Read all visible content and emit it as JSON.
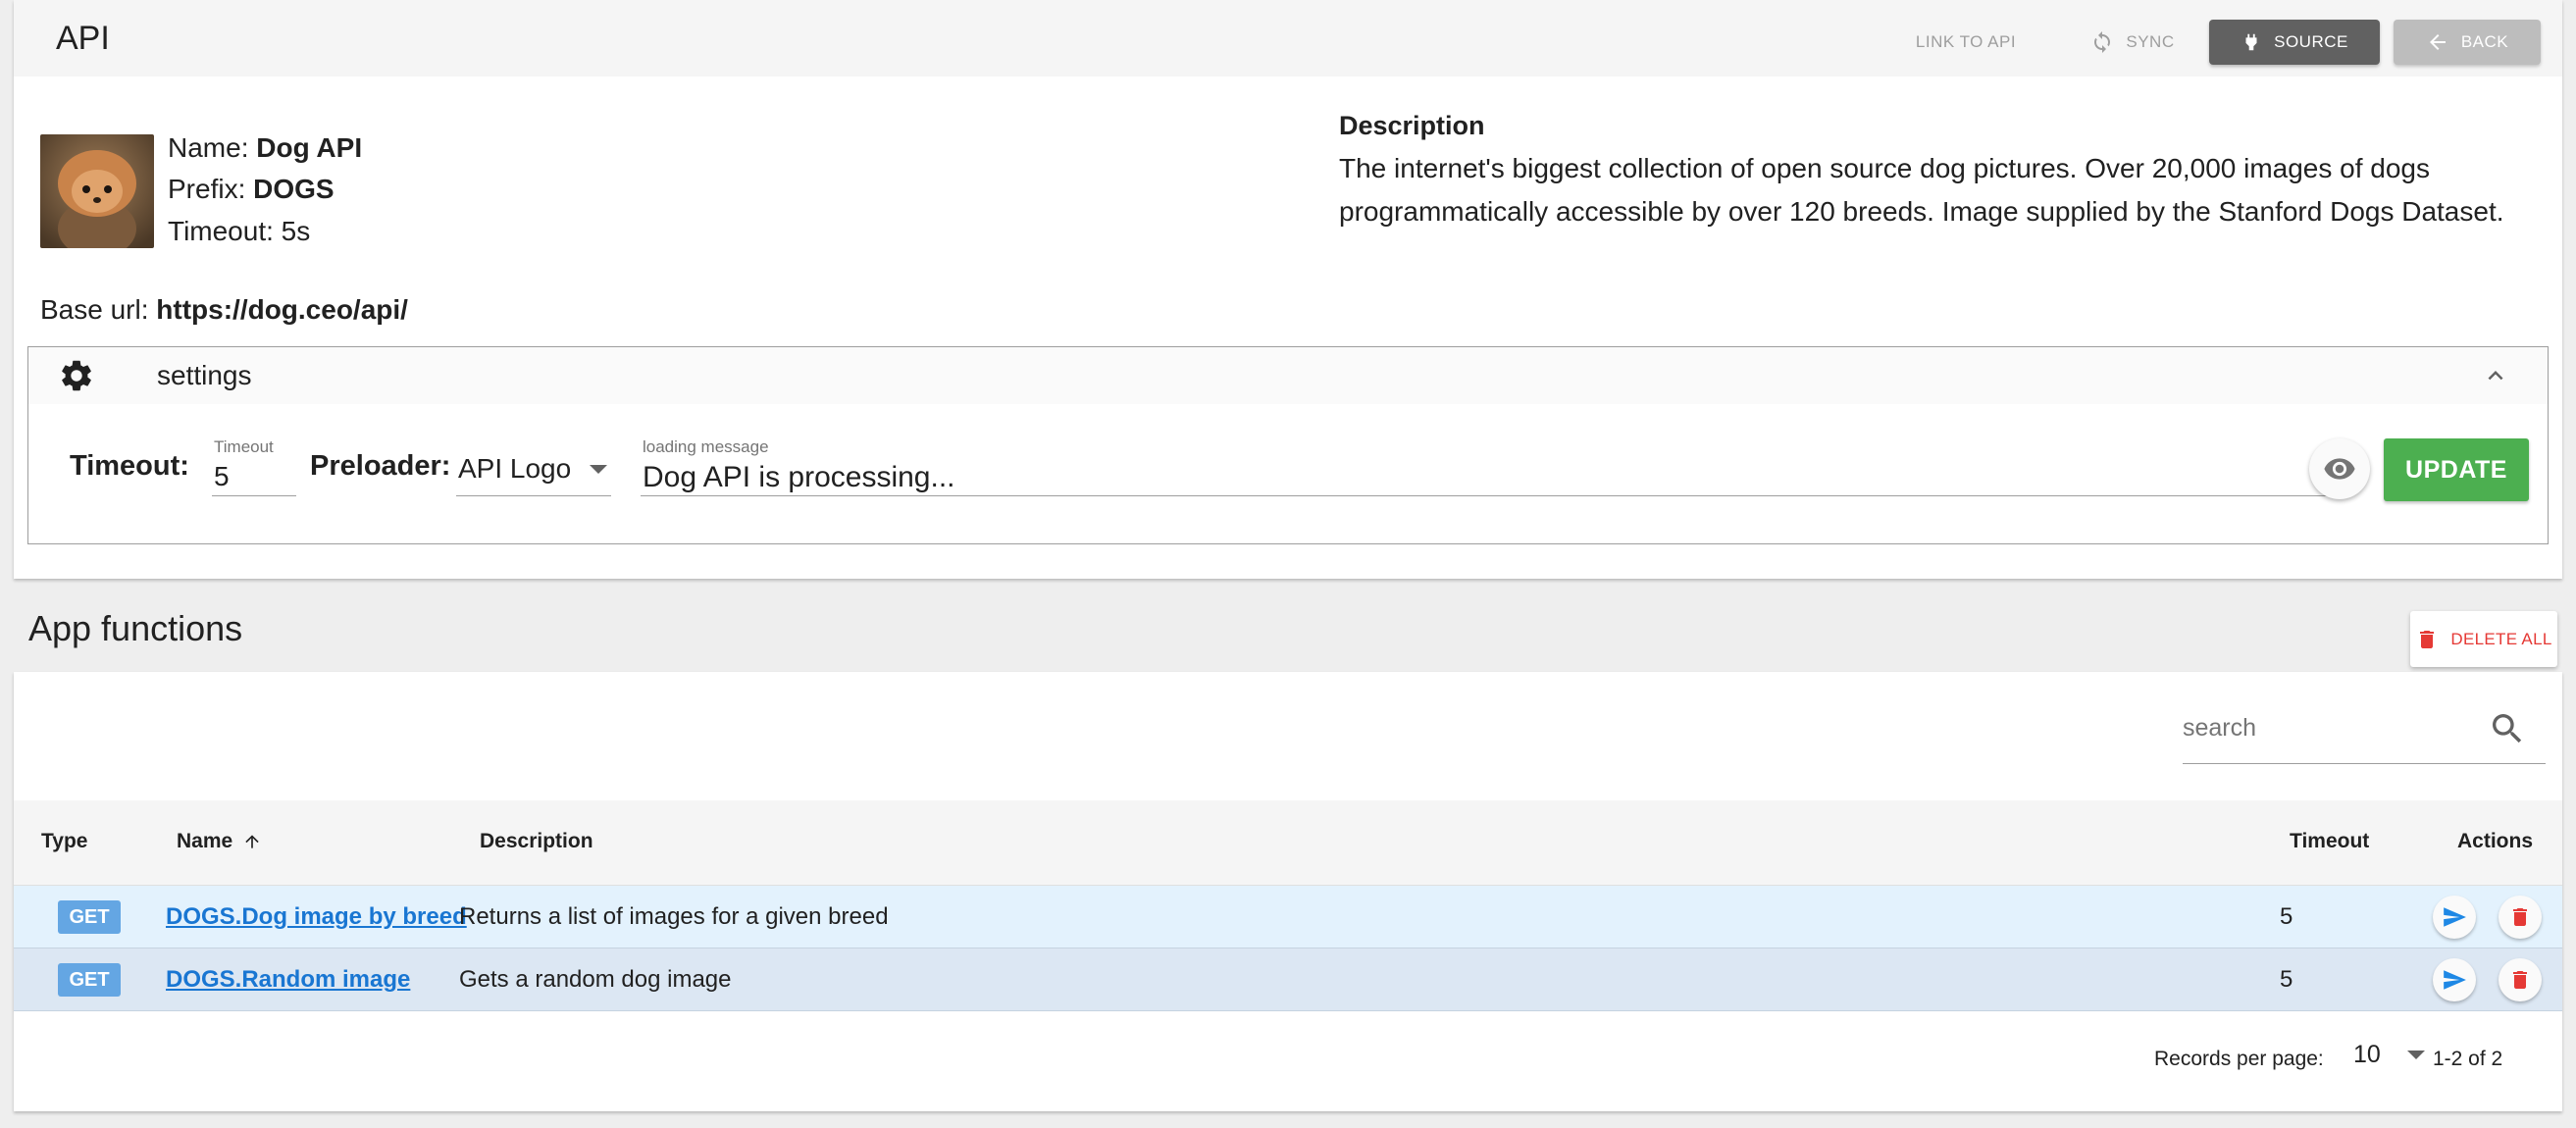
{
  "toolbar": {
    "title": "API",
    "link_label": "LINK TO API",
    "sync_label": "SYNC",
    "source_label": "SOURCE",
    "back_label": "BACK"
  },
  "api": {
    "name_label": "Name:",
    "name": "Dog API",
    "prefix_label": "Prefix:",
    "prefix": "DOGS",
    "timeout_text": "Timeout: 5s",
    "base_url_label": "Base url:",
    "base_url": "https://dog.ceo/api/",
    "description_title": "Description",
    "description": "The internet's biggest collection of open source dog pictures. Over 20,000 images of dogs programmatically accessible by over 120 breeds. Image supplied by the Stanford Dogs Dataset."
  },
  "settings": {
    "title": "settings",
    "timeout_label": "Timeout:",
    "timeout_field_label": "Timeout",
    "timeout_value": "5",
    "preloader_label": "Preloader:",
    "preloader_value": "API Logo",
    "loading_label": "loading message",
    "loading_value": "Dog API is processing...",
    "update_label": "UPDATE"
  },
  "functions": {
    "title": "App functions",
    "delete_all_label": "DELETE ALL",
    "search_placeholder": "search",
    "columns": {
      "type": "Type",
      "name": "Name",
      "description": "Description",
      "timeout": "Timeout",
      "actions": "Actions"
    },
    "rows": [
      {
        "type": "GET",
        "name": "DOGS.Dog image by breed",
        "description": "Returns a list of images for a given breed",
        "timeout": "5"
      },
      {
        "type": "GET",
        "name": "DOGS.Random image",
        "description": "Gets a random dog image",
        "timeout": "5"
      }
    ],
    "records_per_page_label": "Records per page:",
    "records_per_page": "10",
    "range": "1-2 of 2"
  },
  "colors": {
    "update": "#4caf50",
    "delete": "#e53935",
    "link": "#1976d2",
    "badge": "#64a6e3",
    "source_button": "#616161"
  }
}
